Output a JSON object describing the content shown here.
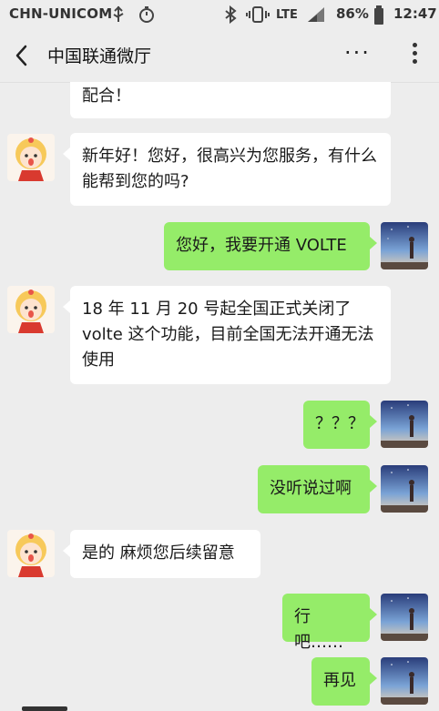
{
  "status_bar": {
    "carrier": "CHN-UNICOM",
    "network": "LTE",
    "battery": "86%",
    "time": "12:47",
    "icons": [
      "usb-icon",
      "timer-icon",
      "bluetooth-icon",
      "vibrate-icon",
      "signal-icon"
    ]
  },
  "header": {
    "title": "中国联通微厅",
    "more_label": "···",
    "icons": [
      "back-arrow-icon",
      "more-horizontal-icon",
      "more-vertical-icon"
    ]
  },
  "messages": [
    {
      "from": "agent",
      "text": "配合！"
    },
    {
      "from": "agent",
      "text": "新年好！您好，很高兴为您服务，有什么能帮到您的吗?"
    },
    {
      "from": "user",
      "text": "您好，我要开通 VOLTE"
    },
    {
      "from": "agent",
      "text": "18 年 11 月 20 号起全国正式关闭了volte 这个功能，目前全国无法开通无法使用"
    },
    {
      "from": "user",
      "text": "？？？"
    },
    {
      "from": "user",
      "text": "没听说过啊"
    },
    {
      "from": "agent",
      "text": "是的 麻烦您后续留意"
    },
    {
      "from": "user",
      "text": "行吧……"
    },
    {
      "from": "user",
      "text": "再见"
    }
  ],
  "colors": {
    "background": "#ededed",
    "user_bubble": "#95ec69",
    "agent_bubble": "#ffffff"
  }
}
